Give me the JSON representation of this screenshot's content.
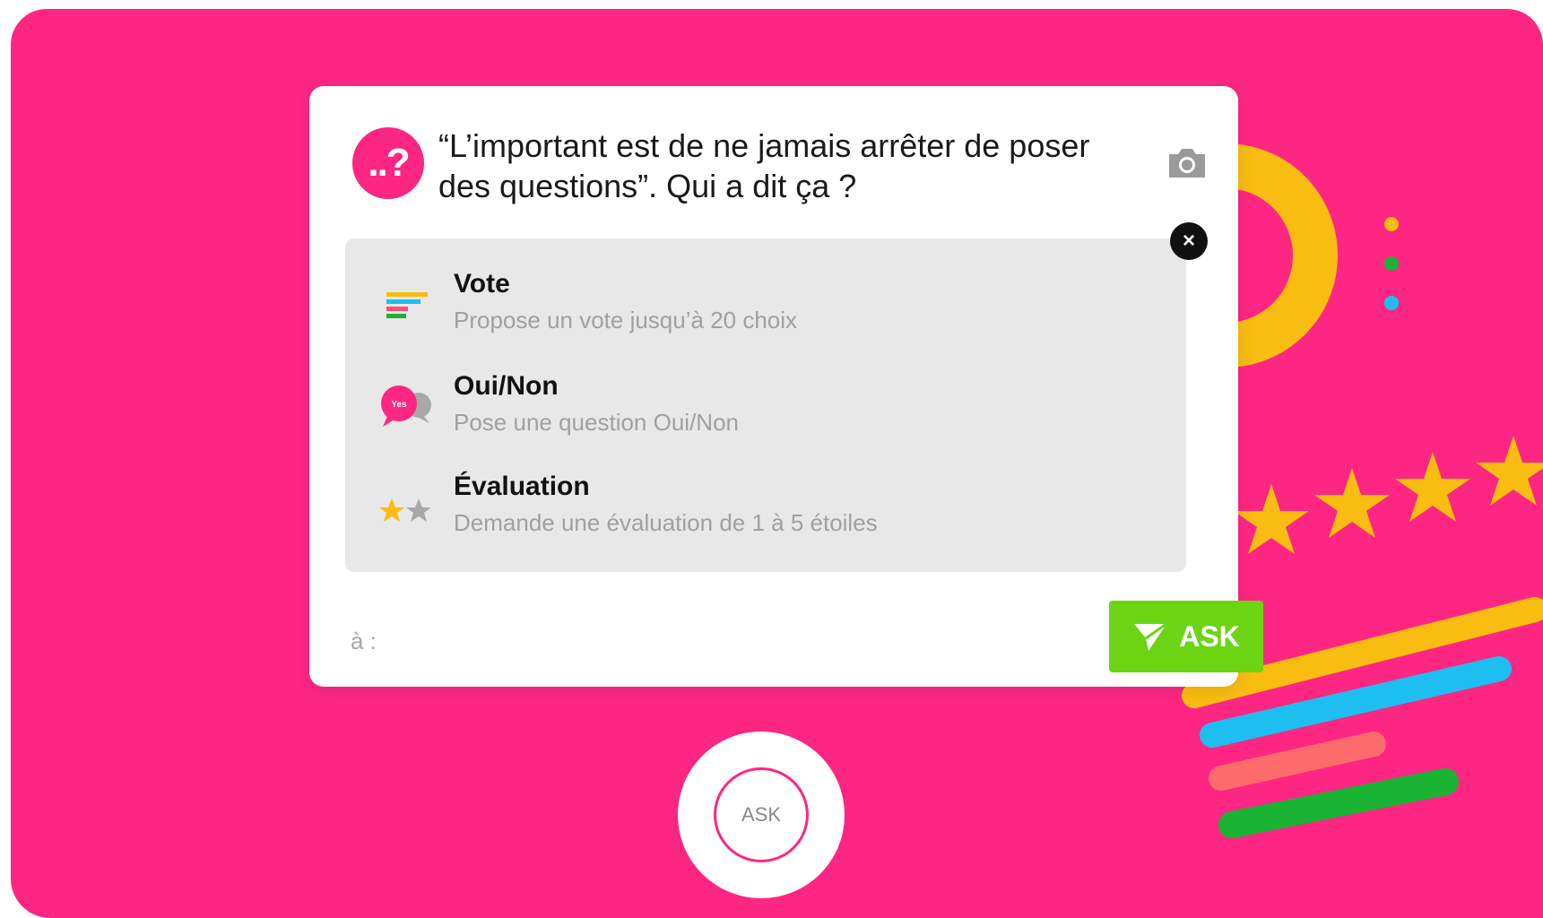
{
  "question": {
    "avatar_text": "..?",
    "text": "“L’important est de ne jamais arrêter de poser des questions”. Qui a dit ça ?"
  },
  "options": [
    {
      "icon": "vote-bars-icon",
      "title": "Vote",
      "description": "Propose un vote jusqu’à 20 choix"
    },
    {
      "icon": "yes-no-bubble-icon",
      "title": "Oui/Non",
      "description": "Pose une question Oui/Non"
    },
    {
      "icon": "stars-rating-icon",
      "title": "Évaluation",
      "description": "Demande une évaluation de 1 à 5 étoiles"
    }
  ],
  "yes_bubble_text": "Yes",
  "recipient": {
    "label": "à :"
  },
  "ask_button": {
    "label": "ASK"
  },
  "big_ask_button": {
    "label": "ASK"
  },
  "colors": {
    "brand_pink": "#fe2683",
    "ask_green": "#6dd414",
    "yellow": "#f9bc10",
    "blue": "#1cbfef",
    "green": "#1ab233",
    "coral": "#ff6b6b"
  }
}
